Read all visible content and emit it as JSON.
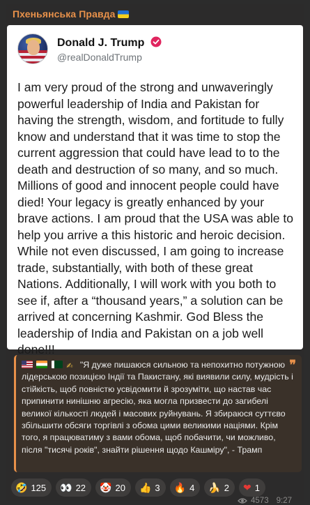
{
  "channel": {
    "name": "Пхеньянська Правда",
    "flag_icon": "ukraine-flag-icon"
  },
  "post": {
    "display_name": "Donald J. Trump",
    "verified_icon": "verified-badge-icon",
    "handle": "@realDonaldTrump",
    "text": "I am very proud of the strong and unwaveringly powerful leadership of India and Pakistan for having the strength, wisdom, and fortitude to fully know and understand that it was time to stop the current aggression that could have lead to to the death and destruction of so many, and so much. Millions of good and innocent people could have died! Your legacy is greatly enhanced by your brave actions. I am proud that the USA was able to help you arrive a this historic and heroic decision. While not even discussed, I am going to increase trade, substantially, with both of these great Nations. Additionally, I will work with you both to see if, after a “thousand years,” a solution can be arrived at concerning Kashmir. God Bless the leadership of India and Pakistan on a job well done!!!"
  },
  "quote": {
    "text": "\"Я дуже пишаюся сильною та непохитно потужною лідерською позицією Індії та Пакистану, які виявили силу, мудрість і стійкість, щоб повністю усвідомити й зрозуміти, що настав час припинити нинішню агресію, яка могла призвести до загибелі великої кількості людей і масових руйнувань. Я збираюся суттєво збільшити обсяги торгівлі з обома цими великими націями. Крім того, я працюватиму з вами обома, щоб побачити, чи можливо, після \"тисячі років\", знайти рішення щодо Кашміру\", - Трамп",
    "mark": "❞"
  },
  "reactions": [
    {
      "emoji": "🤣",
      "icon": "rofl-emoji-icon",
      "count": "125"
    },
    {
      "emoji": "👀",
      "icon": "eyes-emoji-icon",
      "count": "22"
    },
    {
      "emoji": "🤡",
      "icon": "clown-emoji-icon",
      "count": "20"
    },
    {
      "emoji": "👍",
      "icon": "thumbs-up-emoji-icon",
      "count": "3"
    },
    {
      "emoji": "🔥",
      "icon": "fire-emoji-icon",
      "count": "4"
    },
    {
      "emoji": "🍌",
      "icon": "banana-emoji-icon",
      "count": "2"
    },
    {
      "emoji": "❤",
      "icon": "heart-emoji-icon",
      "count": "1"
    }
  ],
  "meta": {
    "views": "4573",
    "time": "9:27"
  },
  "colors": {
    "accent": "#e8914a",
    "background": "#2c2c2c",
    "card": "#ffffff"
  }
}
